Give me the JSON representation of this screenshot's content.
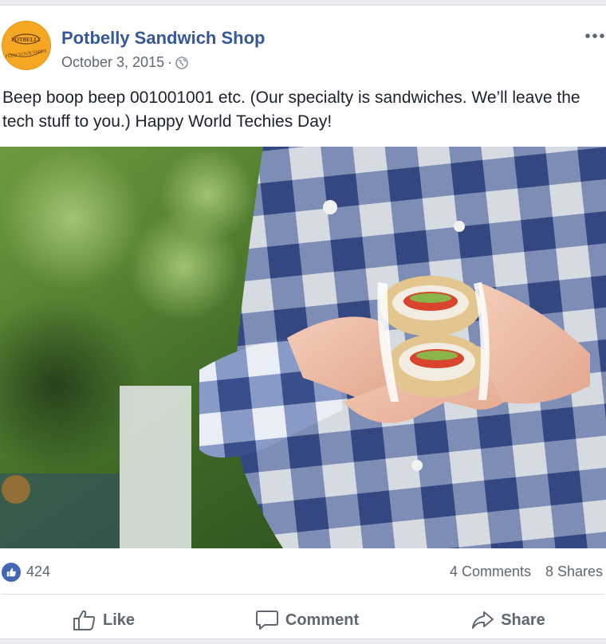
{
  "post": {
    "page_name": "Potbelly Sandwich Shop",
    "date": "October 3, 2015",
    "separator": "·",
    "text": "Beep boop beep 001001001 etc. (Our specialty is sandwiches. We’ll leave the tech stuff to you.) Happy World Techies Day!",
    "avatar": {
      "brand": "POTBELLY",
      "tagline": "FEED YOUR SMILE",
      "color": "#f5a623"
    },
    "privacy_icon": "globe-icon",
    "more_icon": "more-options-icon"
  },
  "stats": {
    "reaction_icon": "like-icon",
    "reaction_count": "424",
    "comments": "4 Comments",
    "shares": "8 Shares"
  },
  "actions": {
    "like": "Like",
    "comment": "Comment",
    "share": "Share"
  },
  "colors": {
    "link_blue": "#365899",
    "meta_gray": "#616770",
    "like_blue": "#4267b2"
  }
}
